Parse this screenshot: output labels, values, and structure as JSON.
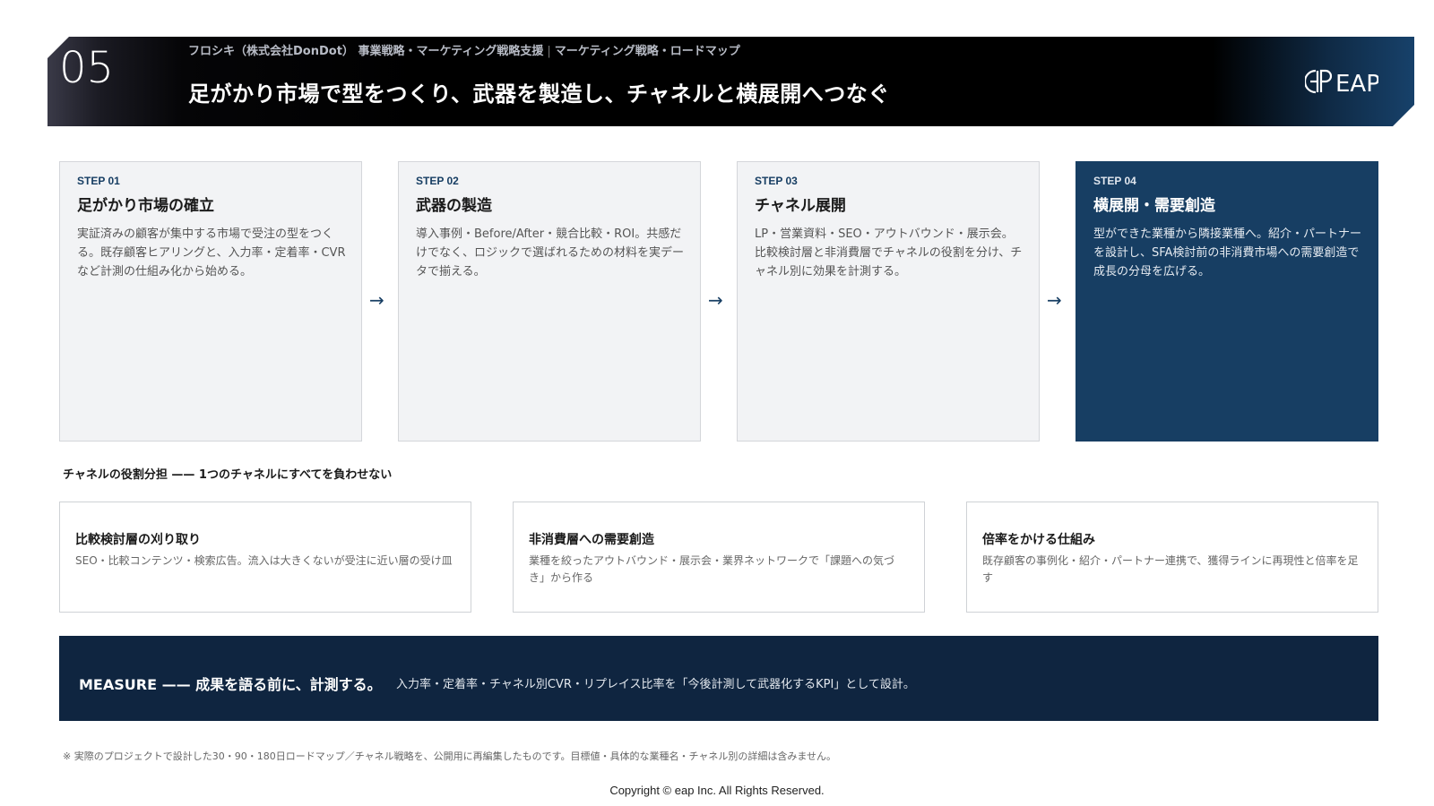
{
  "header": {
    "number": "05",
    "breadcrumb_client": "フロシキ（株式会社DonDot） 事業戦略・マーケティング戦略支援",
    "breadcrumb_separator": "|",
    "breadcrumb_topic": "マーケティング戦略・ロードマップ",
    "title": "足がかり市場で型をつくり、武器を製造し、チャネルと横展開へつなぐ",
    "logo_text": "EAP"
  },
  "steps": [
    {
      "label": "STEP 01",
      "title": "足がかり市場の確立",
      "body": "実証済みの顧客が集中する市場で受注の型をつくる。既存顧客ヒアリングと、入力率・定着率・CVRなど計測の仕組み化から始める。"
    },
    {
      "label": "STEP 02",
      "title": "武器の製造",
      "body": "導入事例・Before/After・競合比較・ROI。共感だけでなく、ロジックで選ばれるための材料を実データで揃える。"
    },
    {
      "label": "STEP 03",
      "title": "チャネル展開",
      "body": "LP・営業資料・SEO・アウトバウンド・展示会。比較検討層と非消費層でチャネルの役割を分け、チャネル別に効果を計測する。"
    },
    {
      "label": "STEP 04",
      "title": "横展開・需要創造",
      "body": "型ができた業種から隣接業種へ。紹介・パートナーを設計し、SFA検討前の非消費市場への需要創造で成長の分母を広げる。"
    }
  ],
  "arrow_glyph": "→",
  "channel_section": {
    "title": "チャネルの役割分担 —— 1つのチャネルにすべてを負わせない",
    "cards": [
      {
        "title": "比較検討層の刈り取り",
        "body": "SEO・比較コンテンツ・検索広告。流入は大きくないが受注に近い層の受け皿"
      },
      {
        "title": "非消費層への需要創造",
        "body": "業種を絞ったアウトバウンド・展示会・業界ネットワークで「課題への気づき」から作る"
      },
      {
        "title": "倍率をかける仕組み",
        "body": "既存顧客の事例化・紹介・パートナー連携で、獲得ラインに再現性と倍率を足す"
      }
    ]
  },
  "measure": {
    "heading": "MEASURE —— 成果を語る前に、計測する。",
    "body": "入力率・定着率・チャネル別CVR・リプレイス比率を「今後計測して武器化するKPI」として設計。"
  },
  "footnote": "※ 実際のプロジェクトで設計した30・90・180日ロードマップ／チャネル戦略を、公開用に再編集したものです。目標値・具体的な業種名・チャネル別の詳細は含みません。",
  "copyright": "Copyright © eap Inc. All Rights Reserved.",
  "colors": {
    "accent_navy": "#173e63",
    "measure_bg": "#0f2540",
    "header_bg": "#000000"
  }
}
